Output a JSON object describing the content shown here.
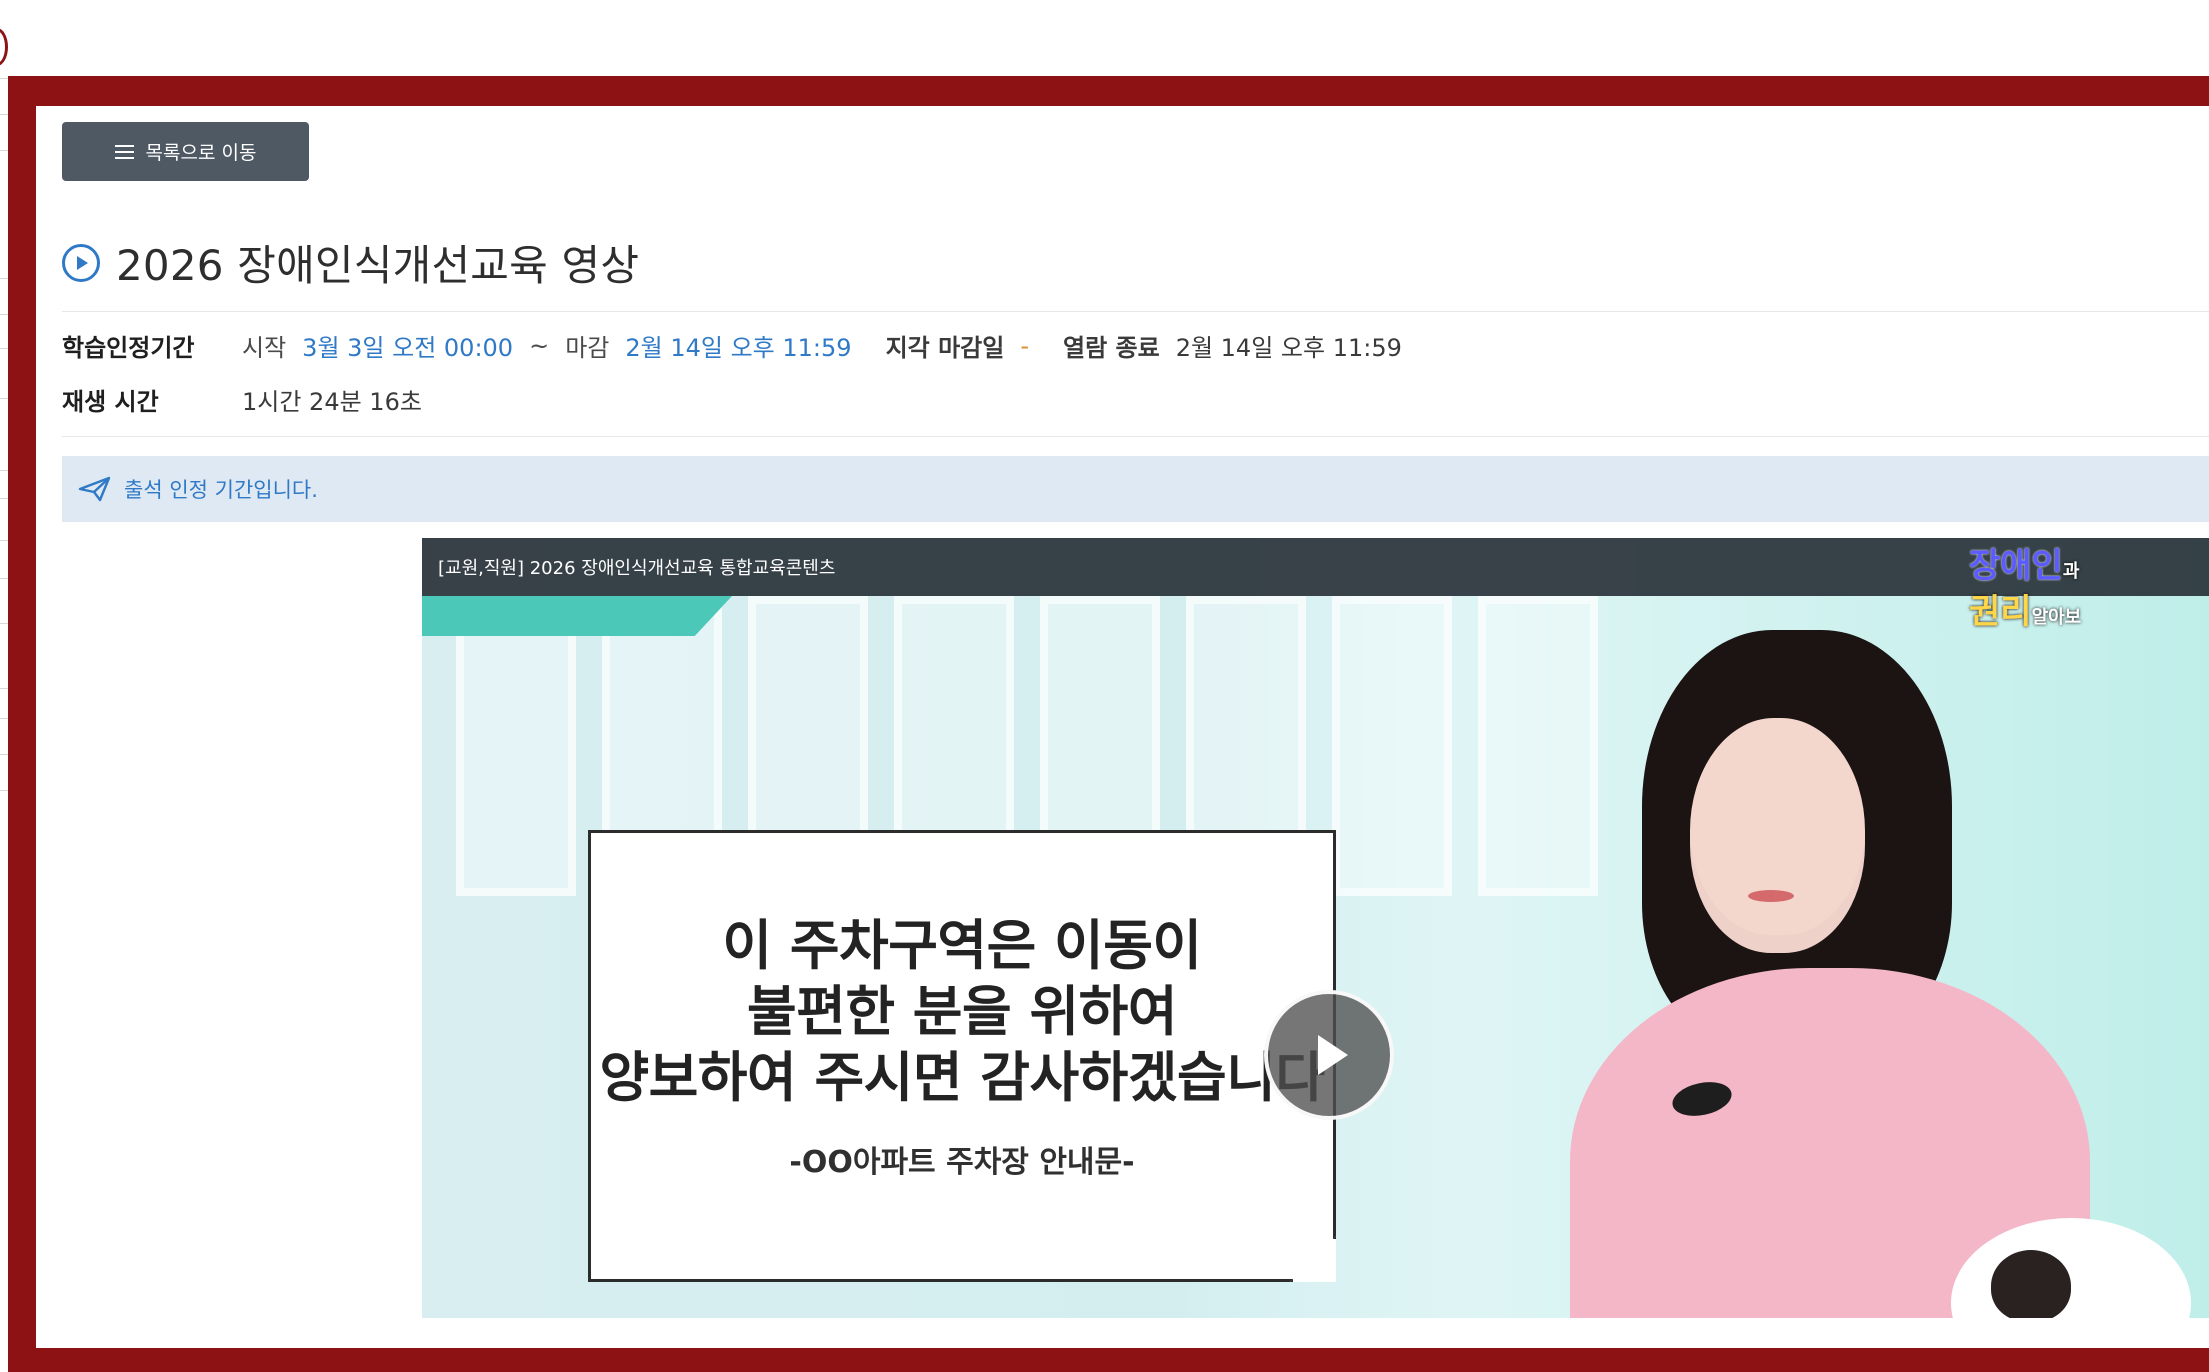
{
  "nav": {
    "back_label": "목록으로 이동"
  },
  "content": {
    "title": "2026 장애인식개선교육 영상",
    "period_label": "학습인정기간",
    "start_label": "시작",
    "start_value": "3월 3일 오전 00:00",
    "separator": "~",
    "deadline_label": "마감",
    "deadline_value": "2월 14일 오후 11:59",
    "late_deadline_label": "지각 마감일",
    "late_deadline_value": "-",
    "view_end_label": "열람 종료",
    "view_end_value": "2월 14일 오후 11:59",
    "play_time_label": "재생 시간",
    "play_time_value": "1시간 24분 16초",
    "notice": "출석 인정 기간입니다."
  },
  "video": {
    "topbar_title": "[교원,직원] 2026 장애인식개선교육 통합교육콘텐츠",
    "badge_right_line1": "장애인",
    "badge_right_line1_small": "과",
    "badge_right_line2": "권리",
    "badge_right_line2_small": "알아보",
    "sign_lines": [
      "이 주차구역은 이동이",
      "불편한 분을 위하여",
      "양보하여 주시면 감사하겠습니다"
    ],
    "sign_caption": "-OO아파트 주차장 안내문-"
  },
  "colors": {
    "frame_red": "#8c1213",
    "button_dark": "#4f5964",
    "link_blue": "#2f79c7",
    "notice_bg": "#dfe9f3",
    "warning_orange": "#e18d2c"
  },
  "icons": {
    "menu": "menu-icon",
    "title": "play-circle-icon",
    "notice": "send-icon",
    "video_play": "play-icon"
  }
}
